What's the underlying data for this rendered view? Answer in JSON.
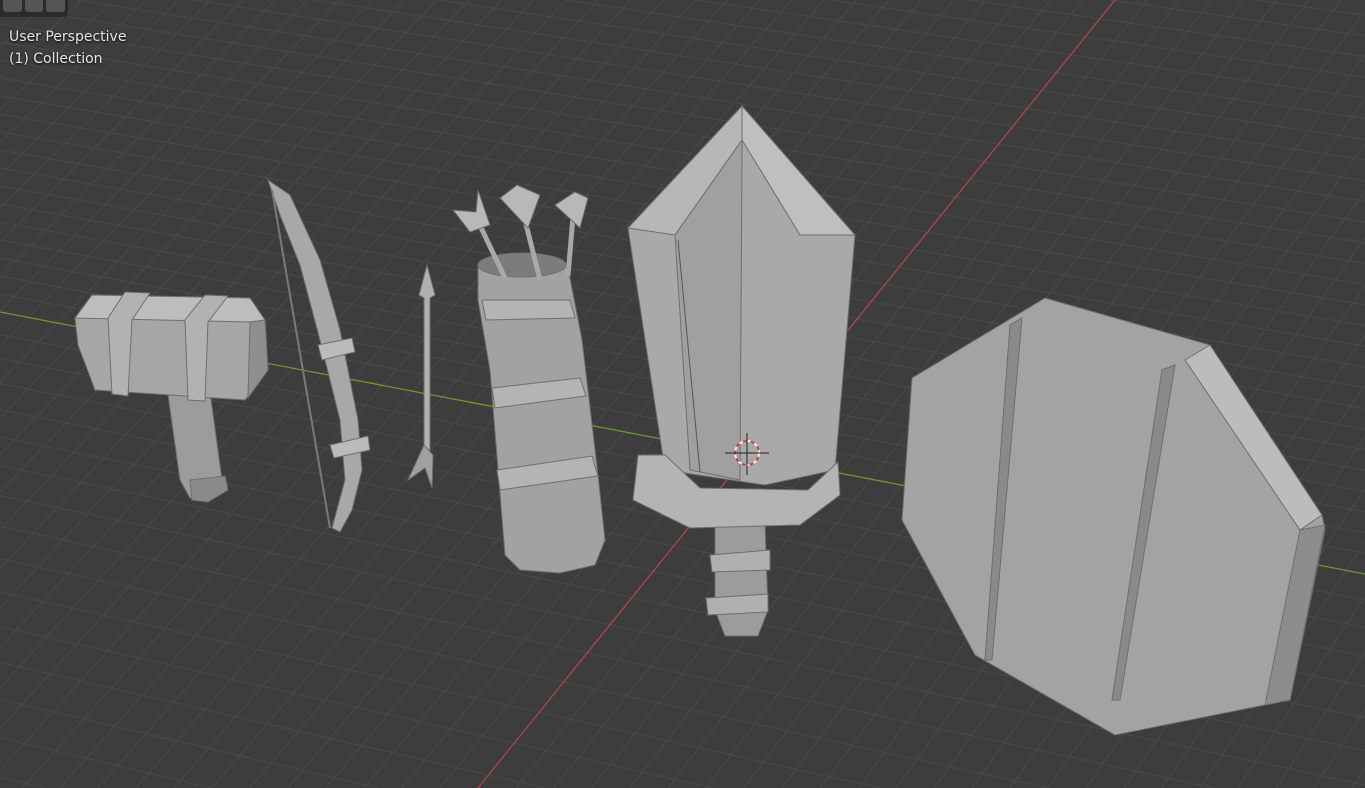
{
  "viewport": {
    "view_label": "User Perspective",
    "collection_label": "(1) Collection",
    "colors": {
      "background": "#3d3d3d",
      "grid": "#4a4a4a",
      "x_axis": "#b0424c",
      "y_axis": "#6a9a2c",
      "mesh": "#a4a4a4"
    },
    "objects": [
      "hammer",
      "bow",
      "arrow",
      "quiver",
      "sword",
      "shield"
    ]
  }
}
